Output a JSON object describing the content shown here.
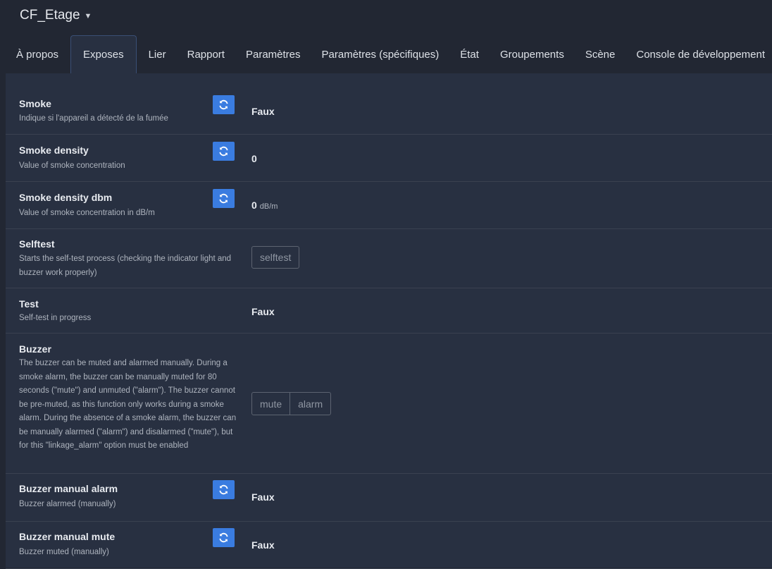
{
  "device": {
    "name": "CF_Etage"
  },
  "tabs": [
    {
      "label": "À propos"
    },
    {
      "label": "Exposes"
    },
    {
      "label": "Lier"
    },
    {
      "label": "Rapport"
    },
    {
      "label": "Paramètres"
    },
    {
      "label": "Paramètres (spécifiques)"
    },
    {
      "label": "État"
    },
    {
      "label": "Groupements"
    },
    {
      "label": "Scène"
    },
    {
      "label": "Console de développement"
    }
  ],
  "active_tab": "Exposes",
  "exposes": [
    {
      "label": "Smoke",
      "description": "Indique si l'appareil a détecté de la fumée",
      "value": "Faux"
    },
    {
      "label": "Smoke density",
      "description": "Value of smoke concentration",
      "value": "0"
    },
    {
      "label": "Smoke density dbm",
      "description": "Value of smoke concentration in dB/m",
      "value": "0",
      "unit": "dB/m"
    },
    {
      "label": "Selftest",
      "description": "Starts the self-test process (checking the indicator light and buzzer work properly)",
      "button": "selftest"
    },
    {
      "label": "Test",
      "description": "Self-test in progress",
      "value": "Faux"
    },
    {
      "label": "Buzzer",
      "description": "The buzzer can be muted and alarmed manually. During a smoke alarm, the buzzer can be manually muted for 80 seconds (\"mute\") and unmuted (\"alarm\"). The buzzer cannot be pre-muted, as this function only works during a smoke alarm. During the absence of a smoke alarm, the buzzer can be manually alarmed (\"alarm\") and disalarmed (\"mute\"), but for this \"linkage_alarm\" option must be enabled",
      "options": [
        "mute",
        "alarm"
      ]
    },
    {
      "label": "Buzzer manual alarm",
      "description": "Buzzer alarmed (manually)",
      "value": "Faux"
    },
    {
      "label": "Buzzer manual mute",
      "description": "Buzzer muted (manually)",
      "value": "Faux"
    }
  ],
  "colors": {
    "accent": "#3a7ce0",
    "background": "#222733",
    "panel": "#283041"
  },
  "icons": {
    "refresh": "refresh-icon",
    "caret": "chevron-down-icon"
  }
}
